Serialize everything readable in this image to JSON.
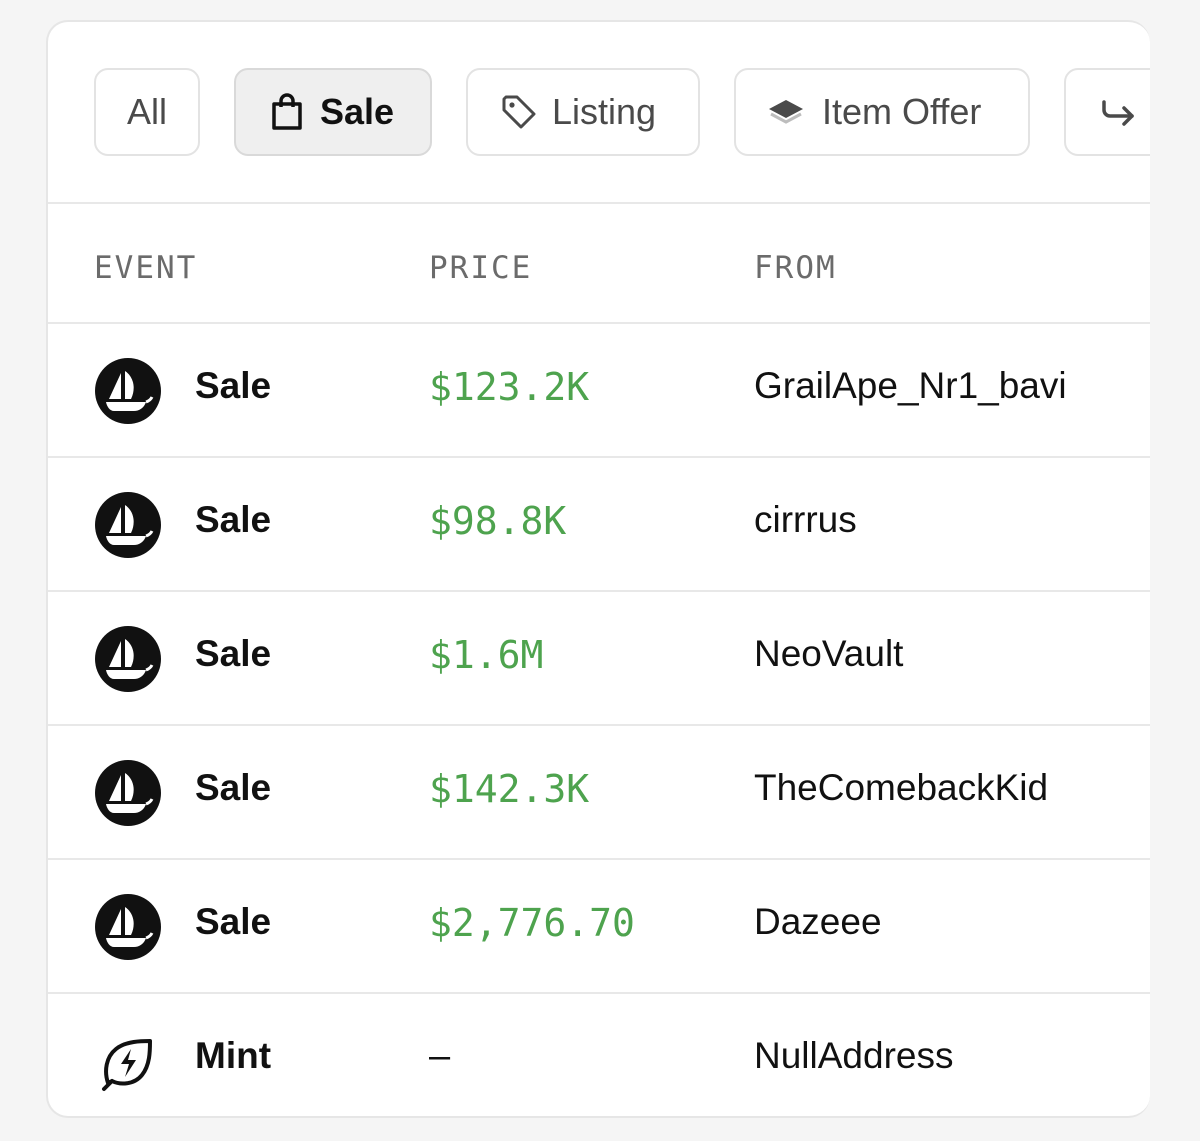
{
  "filters": {
    "all": "All",
    "sale": "Sale",
    "listing": "Listing",
    "item_offer": "Item Offer"
  },
  "table": {
    "headers": {
      "event": "EVENT",
      "price": "PRICE",
      "from": "FROM"
    },
    "rows": [
      {
        "event": "Sale",
        "icon": "opensea-icon",
        "price": "$123.2K",
        "from": "GrailApe_Nr1_bavi"
      },
      {
        "event": "Sale",
        "icon": "opensea-icon",
        "price": "$98.8K",
        "from": "cirrrus"
      },
      {
        "event": "Sale",
        "icon": "opensea-icon",
        "price": "$1.6M",
        "from": "NeoVault"
      },
      {
        "event": "Sale",
        "icon": "opensea-icon",
        "price": "$142.3K",
        "from": "TheComebackKid"
      },
      {
        "event": "Sale",
        "icon": "opensea-icon",
        "price": "$2,776.70",
        "from": "Dazeee"
      },
      {
        "event": "Mint",
        "icon": "mint-icon",
        "price": "–",
        "from": "NullAddress"
      }
    ]
  },
  "colors": {
    "price_green": "#4ea34e",
    "active_chip_bg": "#efefef"
  }
}
